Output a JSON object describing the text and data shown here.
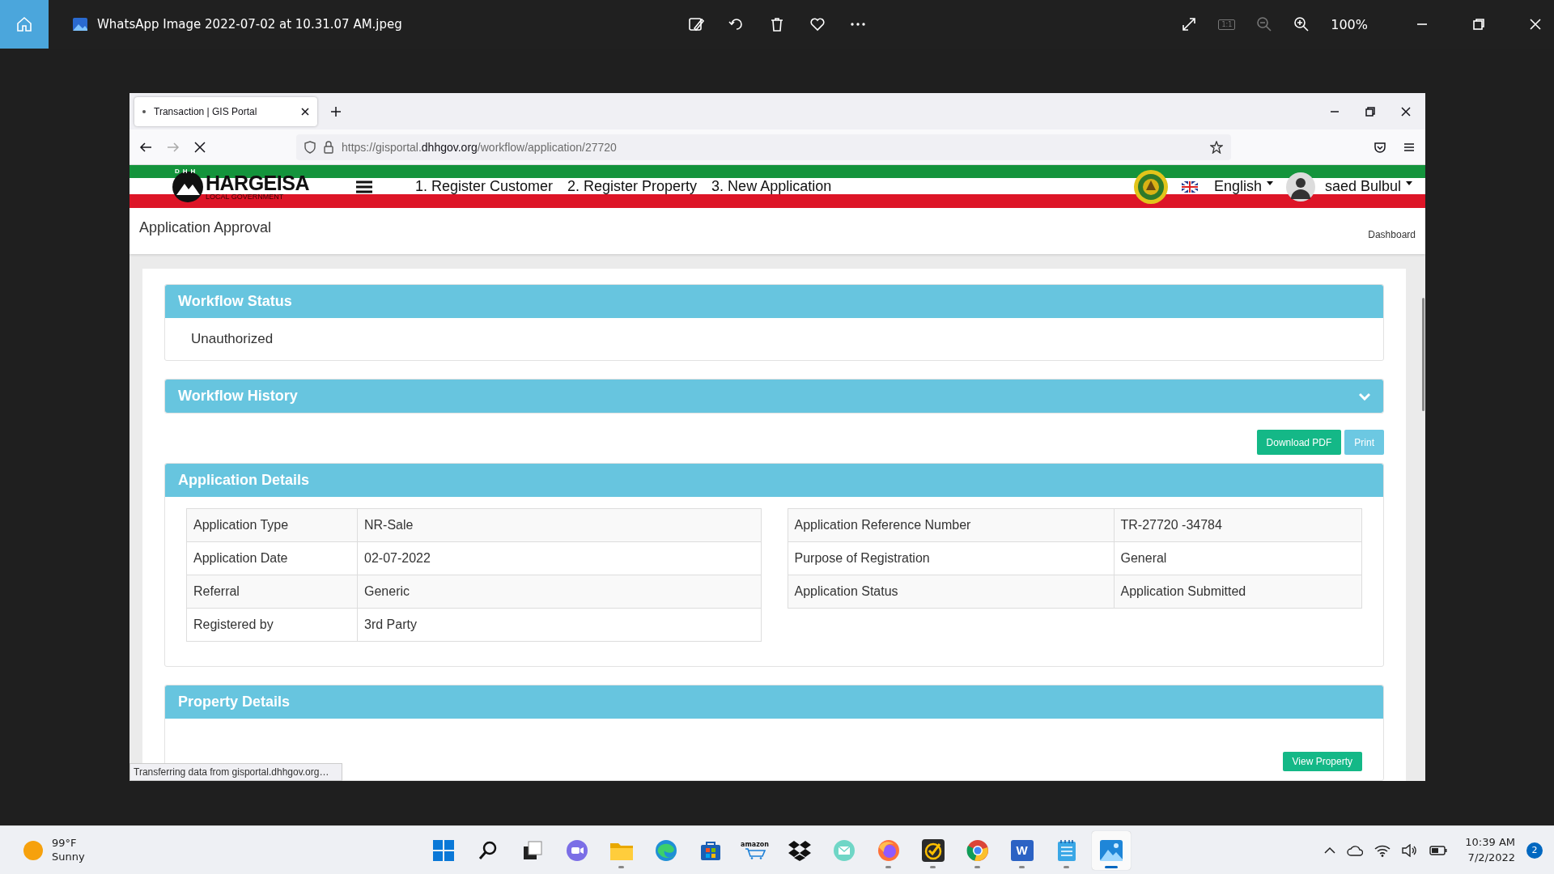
{
  "photos_bar": {
    "title": "WhatsApp Image 2022-07-02 at 10.31.07 AM.jpeg",
    "actual_size": "1:1",
    "zoom": "100%"
  },
  "browser": {
    "tab_title": "Transaction | GIS Portal",
    "url": "https://gisportal.**dhhgov.org**/workflow/application/27720",
    "status_text": "Transferring data from gisportal.dhhgov.org…"
  },
  "site_header": {
    "logo": {
      "badge": "DHH",
      "name": "HARGEISA",
      "subtitle": "LOCAL GOVERNMENT"
    },
    "nav": [
      "1. Register Customer",
      "2. Register Property",
      "3. New Application"
    ],
    "language": "English",
    "user": "saed Bulbul"
  },
  "page": {
    "title": "Application Approval",
    "breadcrumb": "Dashboard"
  },
  "workflow_status": {
    "title": "Workflow Status",
    "value": "Unauthorized"
  },
  "workflow_history": {
    "title": "Workflow History",
    "expanded": false
  },
  "actions": [
    {
      "label": "Download PDF",
      "kind": "success"
    },
    {
      "label": "Print",
      "kind": "info"
    }
  ],
  "application_details": {
    "title": "Application Details",
    "left_table": [
      {
        "label": "Application Type",
        "value": "NR-Sale"
      },
      {
        "label": "Application Date",
        "value": "02-07-2022"
      },
      {
        "label": "Referral",
        "value": "Generic"
      },
      {
        "label": "Registered by",
        "value": "3rd Party"
      }
    ],
    "right_table": [
      {
        "label": "Application Reference Number",
        "value": "TR-27720 -34784"
      },
      {
        "label": "Purpose of Registration",
        "value": "General"
      },
      {
        "label": "Application Status",
        "value": "Application Submitted"
      }
    ]
  },
  "property_details": {
    "title": "Property Details",
    "button": "View Property"
  },
  "taskbar": {
    "weather": {
      "temperature": "99°F",
      "condition": "Sunny"
    },
    "apps": [
      {
        "kind": "start",
        "running": false,
        "selected": false
      },
      {
        "kind": "search",
        "running": false,
        "selected": false
      },
      {
        "kind": "taskview",
        "running": false,
        "selected": false
      },
      {
        "kind": "chat",
        "running": false,
        "selected": false
      },
      {
        "kind": "explorer",
        "running": true,
        "selected": false
      },
      {
        "kind": "edge",
        "running": false,
        "selected": false
      },
      {
        "kind": "store",
        "running": false,
        "selected": false
      },
      {
        "kind": "amazon",
        "label": "amazon",
        "running": false,
        "selected": false
      },
      {
        "kind": "dropbox",
        "running": false,
        "selected": false
      },
      {
        "kind": "messenger",
        "running": false,
        "selected": false
      },
      {
        "kind": "firefox",
        "running": true,
        "selected": false
      },
      {
        "kind": "tasks",
        "running": true,
        "selected": false
      },
      {
        "kind": "chrome",
        "running": true,
        "selected": false
      },
      {
        "kind": "word",
        "label": "W",
        "running": true,
        "selected": false
      },
      {
        "kind": "notepad",
        "running": true,
        "selected": false
      },
      {
        "kind": "photos",
        "running": true,
        "selected": true
      }
    ],
    "clock": {
      "time": "10:39 AM",
      "date": "7/2/2022"
    },
    "notifications": "2"
  }
}
